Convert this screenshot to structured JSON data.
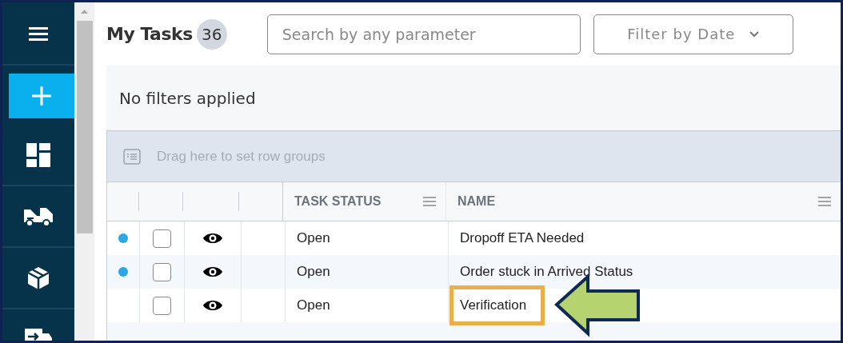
{
  "sidebar": {
    "items": [
      {
        "kind": "menu",
        "selected": false
      },
      {
        "kind": "add",
        "selected": true
      },
      {
        "kind": "dashboard",
        "selected": false
      },
      {
        "kind": "truck",
        "selected": false
      },
      {
        "kind": "box",
        "selected": false
      },
      {
        "kind": "delivery",
        "selected": false
      }
    ]
  },
  "header": {
    "title": "My Tasks",
    "count": "36",
    "search": {
      "placeholder": "Search by any parameter"
    },
    "date_filter": {
      "label": "Filter by Date"
    }
  },
  "filters": {
    "text": "No filters applied"
  },
  "group_bar": {
    "placeholder": "Drag here to set row groups"
  },
  "table": {
    "columns": [
      {
        "label": "TASK STATUS"
      },
      {
        "label": "NAME"
      }
    ],
    "rows": [
      {
        "unread": true,
        "checked": false,
        "status": "Open",
        "name": "Dropoff ETA Needed",
        "highlighted": false
      },
      {
        "unread": true,
        "checked": false,
        "status": "Open",
        "name": "Order stuck in Arrived Status",
        "highlighted": false
      },
      {
        "unread": false,
        "checked": false,
        "status": "Open",
        "name": "Verification",
        "highlighted": true
      }
    ]
  }
}
